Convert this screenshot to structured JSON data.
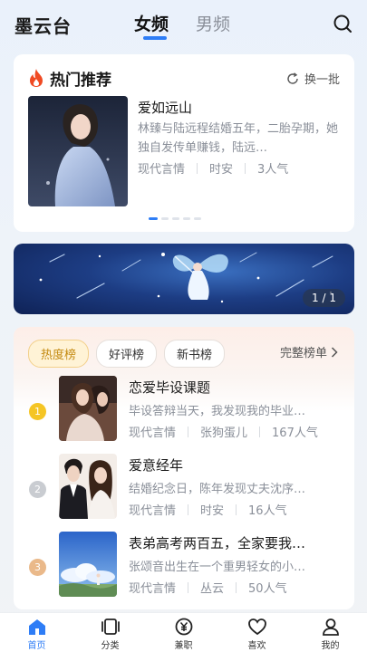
{
  "header": {
    "app_title": "墨云台",
    "tabs": [
      {
        "label": "女频",
        "active": true
      },
      {
        "label": "男频",
        "active": false
      }
    ],
    "search_icon": "search-icon"
  },
  "hot": {
    "title": "热门推荐",
    "icon": "fire-icon",
    "refresh_label": "换一批",
    "book": {
      "title": "爱如远山",
      "desc": "林臻与陆远程结婚五年，二胎孕期，她独自发传单赚钱，陆远…",
      "genre": "现代言情",
      "author": "时安",
      "popularity": "3人气"
    },
    "carousel_pages": 5,
    "carousel_active": 0
  },
  "banner": {
    "counter": "1 / 1"
  },
  "ranking": {
    "tabs": [
      {
        "label": "热度榜",
        "active": true
      },
      {
        "label": "好评榜",
        "active": false
      },
      {
        "label": "新书榜",
        "active": false
      }
    ],
    "full_label": "完整榜单",
    "items": [
      {
        "rank": "1",
        "title": "恋爱毕设课题",
        "desc": "毕设答辩当天，我发现我的毕业…",
        "genre": "现代言情",
        "author": "张狗蛋儿",
        "popularity": "167人气"
      },
      {
        "rank": "2",
        "title": "爱意经年",
        "desc": "结婚纪念日，陈年发现丈夫沈序…",
        "genre": "现代言情",
        "author": "时安",
        "popularity": "16人气"
      },
      {
        "rank": "3",
        "title": "表弟高考两百五，全家要我…",
        "desc": "张颂音出生在一个重男轻女的小…",
        "genre": "现代言情",
        "author": "丛云",
        "popularity": "50人气"
      }
    ],
    "rank_colors": [
      "#f5c524",
      "#c9ccd1",
      "#eab98a"
    ]
  },
  "nav": {
    "items": [
      {
        "label": "首页",
        "icon": "home-icon",
        "active": true
      },
      {
        "label": "分类",
        "icon": "category-icon",
        "active": false
      },
      {
        "label": "兼职",
        "icon": "yuan-icon",
        "active": false
      },
      {
        "label": "喜欢",
        "icon": "heart-icon",
        "active": false
      },
      {
        "label": "我的",
        "icon": "user-icon",
        "active": false
      }
    ]
  },
  "colors": {
    "accent": "#2e7df6",
    "fire": "#f04a23"
  }
}
